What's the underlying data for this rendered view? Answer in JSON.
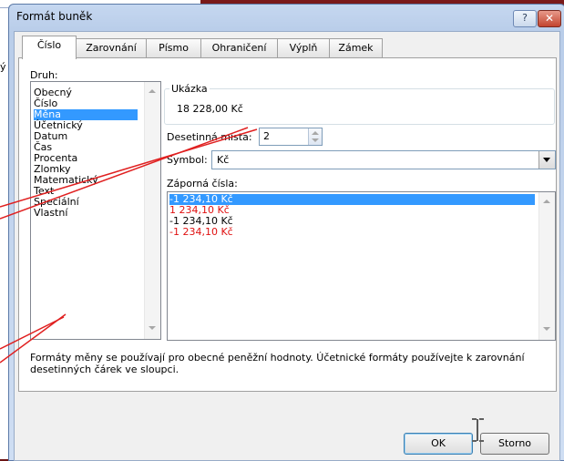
{
  "background": {
    "left_fragment_text": "ý s"
  },
  "dialog": {
    "title": "Formát buněk",
    "help_label": "?",
    "close_label": "✕",
    "tabs": [
      {
        "label": "Číslo",
        "active": true
      },
      {
        "label": "Zarovnání",
        "active": false
      },
      {
        "label": "Písmo",
        "active": false
      },
      {
        "label": "Ohraničení",
        "active": false
      },
      {
        "label": "Výplň",
        "active": false
      },
      {
        "label": "Zámek",
        "active": false
      }
    ],
    "category_label": "Druh:",
    "categories": [
      "Obecný",
      "Číslo",
      "Měna",
      "Účetnický",
      "Datum",
      "Čas",
      "Procenta",
      "Zlomky",
      "Matematický",
      "Text",
      "Speciální",
      "Vlastní"
    ],
    "selected_category": "Měna",
    "sample_group_label": "Ukázka",
    "sample_value": "18 228,00 Kč",
    "decimal_label": "Desetinná místa:",
    "decimal_value": "2",
    "symbol_label": "Symbol:",
    "symbol_value": "Kč",
    "negative_label": "Záporná čísla:",
    "negative_formats": [
      {
        "text": "-1 234,10 Kč",
        "red": false,
        "selected": true
      },
      {
        "text": "1 234,10 Kč",
        "red": true,
        "selected": false
      },
      {
        "text": "-1 234,10 Kč",
        "red": false,
        "selected": false
      },
      {
        "text": "-1 234,10 Kč",
        "red": true,
        "selected": false
      }
    ],
    "description": "Formáty měny se používají pro obecné peněžní hodnoty. Účetnické formáty používejte k zarovnání desetinných čárek ve sloupci.",
    "ok_label": "OK",
    "cancel_label": "Storno"
  },
  "colors": {
    "selection": "#3399ff",
    "negative_red": "#e01010",
    "annotation_red": "#e02020"
  }
}
